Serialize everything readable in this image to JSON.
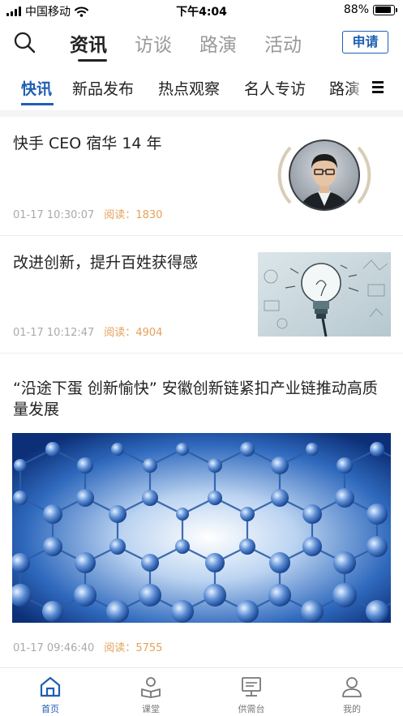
{
  "status_bar": {
    "carrier": "中国移动",
    "time": "下午4:04",
    "battery": "88%",
    "battery_level": 0.88
  },
  "top_nav": {
    "tabs": [
      {
        "label": "资讯",
        "active": true
      },
      {
        "label": "访谈",
        "active": false
      },
      {
        "label": "路演",
        "active": false
      },
      {
        "label": "活动",
        "active": false
      }
    ],
    "apply_label": "申请"
  },
  "sub_nav": {
    "tabs": [
      {
        "label": "快讯",
        "active": true
      },
      {
        "label": "新品发布",
        "active": false
      },
      {
        "label": "热点观察",
        "active": false
      },
      {
        "label": "名人专访",
        "active": false
      },
      {
        "label": "路演",
        "active": false
      }
    ]
  },
  "articles": [
    {
      "title": "快手 CEO 宿华 14 年",
      "time": "01-17 10:30:07",
      "reads_label": "阅读：",
      "reads": "1830",
      "image": "portrait-photo"
    },
    {
      "title": "改进创新，提升百姓获得感",
      "time": "01-17 10:12:47",
      "reads_label": "阅读：",
      "reads": "4904",
      "image": "lightbulb-sketch"
    },
    {
      "title": "“沿途下蛋 创新愉快” 安徽创新链紧扣产业链推动高质量发展",
      "time": "01-17 09:46:40",
      "reads_label": "阅读：",
      "reads": "5755",
      "image": "molecular-lattice"
    }
  ],
  "tab_bar": {
    "items": [
      {
        "label": "首页",
        "icon": "home-icon",
        "active": true
      },
      {
        "label": "课堂",
        "icon": "classroom-icon",
        "active": false
      },
      {
        "label": "供需台",
        "icon": "supply-demand-icon",
        "active": false
      },
      {
        "label": "我的",
        "icon": "profile-icon",
        "active": false
      }
    ]
  },
  "colors": {
    "accent": "#1e5fb4",
    "reads": "#e5a05a",
    "meta": "#aaaaaa"
  }
}
